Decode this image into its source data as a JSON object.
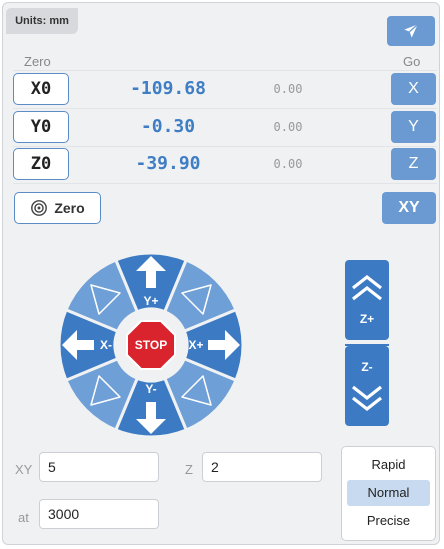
{
  "units_label": "Units: mm",
  "header": {
    "zero_label": "Zero",
    "go_label": "Go"
  },
  "axes": [
    {
      "zero_label": "X0",
      "position": "-109.68",
      "machine": "0.00",
      "go_label": "X"
    },
    {
      "zero_label": "Y0",
      "position": "-0.30",
      "machine": "0.00",
      "go_label": "Y"
    },
    {
      "zero_label": "Z0",
      "position": "-39.90",
      "machine": "0.00",
      "go_label": "Z"
    }
  ],
  "zero_all_label": "Zero",
  "xy_go_label": "XY",
  "jog": {
    "y_plus": "Y+",
    "y_minus": "Y-",
    "x_plus": "X+",
    "x_minus": "X-",
    "stop": "STOP"
  },
  "z_jog": {
    "plus": "Z+",
    "minus": "Z-"
  },
  "step": {
    "xy_label": "XY",
    "xy_value": "5",
    "z_label": "Z",
    "z_value": "2",
    "feed_label": "at",
    "feed_value": "3000"
  },
  "speed": {
    "options": [
      "Rapid",
      "Normal",
      "Precise"
    ],
    "selected": "Normal"
  },
  "colors": {
    "accent": "#3c7bc4",
    "button": "#6a9ad1",
    "jog_light": "#6e9fd6",
    "stop": "#d9232d"
  },
  "icons": {
    "send": "paper-plane-icon",
    "target": "crosshair-target-icon"
  }
}
